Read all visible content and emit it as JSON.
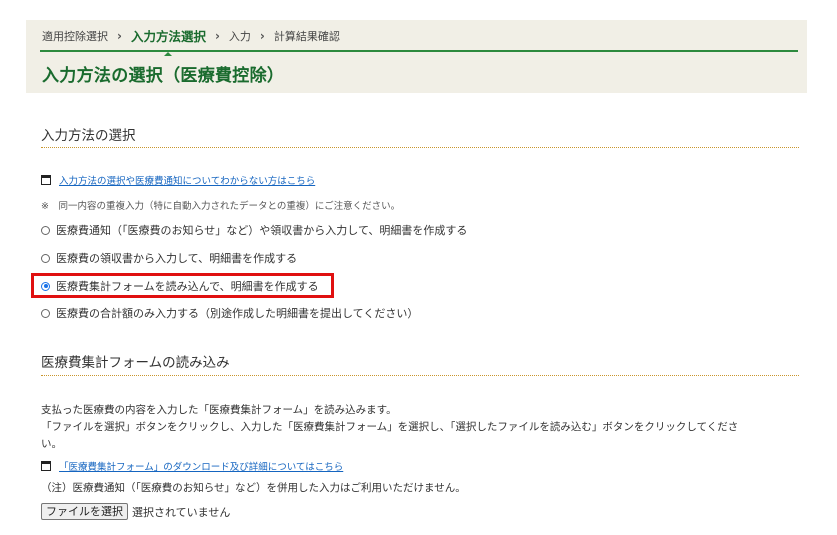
{
  "breadcrumb": {
    "step1": "適用控除選択",
    "step2": "入力方法選択",
    "step3": "入力",
    "step4": "計算結果確認",
    "separator": "›"
  },
  "page_title": "入力方法の選択（医療費控除）",
  "method_section": {
    "heading": "入力方法の選択",
    "help_link": "入力方法の選択や医療費通知についてわからない方はこちら",
    "note": "※　同一内容の重複入力（特に自動入力されたデータとの重複）にご注意ください。",
    "options": [
      {
        "label": "医療費通知（「医療費のお知らせ」など）や領収書から入力して、明細書を作成する",
        "checked": false
      },
      {
        "label": "医療費の領収書から入力して、明細書を作成する",
        "checked": false
      },
      {
        "label": "医療費集計フォームを読み込んで、明細書を作成する",
        "checked": true
      },
      {
        "label": "医療費の合計額のみ入力する（別途作成した明細書を提出してください）",
        "checked": false
      }
    ]
  },
  "form_section": {
    "heading": "医療費集計フォームの読み込み",
    "description_line1": "支払った医療費の内容を入力した「医療費集計フォーム」を読み込みます。",
    "description_line2": "「ファイルを選択」ボタンをクリックし、入力した「医療費集計フォーム」を選択し、「選択したファイルを読み込む」ボタンをクリックしてくださ",
    "description_line3": "い。",
    "download_link": "「医療費集計フォーム」のダウンロード及び詳細についてはこちら",
    "caution": "（注）医療費通知（「医療費のお知らせ」など）を併用した入力はご利用いただけません。",
    "file_button": "ファイルを選択",
    "file_status": "選択されていません"
  },
  "colors": {
    "title_green": "#1a6b2e",
    "rule_green": "#2d8a3e",
    "link_blue": "#1565c0",
    "highlight_red": "#e01010",
    "header_bg": "#f1efe6",
    "dotted_gold": "#c9962e"
  }
}
